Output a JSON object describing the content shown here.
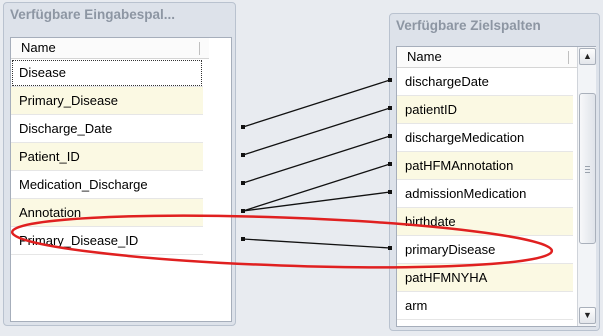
{
  "source_panel": {
    "title": "Verfügbare Eingabespal...",
    "column_header": "Name",
    "items": [
      {
        "label": "Disease"
      },
      {
        "label": "Primary_Disease"
      },
      {
        "label": "Discharge_Date"
      },
      {
        "label": "Patient_ID"
      },
      {
        "label": "Medication_Discharge"
      },
      {
        "label": "Annotation"
      },
      {
        "label": "Primary_Disease_ID"
      }
    ]
  },
  "target_panel": {
    "title": "Verfügbare Zielspalten",
    "column_header": "Name",
    "items": [
      {
        "label": "dischargeDate"
      },
      {
        "label": "patientID"
      },
      {
        "label": "dischargeMedication"
      },
      {
        "label": "patHFMAnnotation"
      },
      {
        "label": "admissionMedication"
      },
      {
        "label": "birthdate"
      },
      {
        "label": "primaryDisease"
      },
      {
        "label": "patHFMNYHA"
      },
      {
        "label": "arm"
      }
    ],
    "scrollbar": {
      "up_icon": "▲",
      "down_icon": "▼"
    }
  },
  "mappings": [
    {
      "source": "Discharge_Date",
      "target": "dischargeDate"
    },
    {
      "source": "Patient_ID",
      "target": "patientID"
    },
    {
      "source": "Medication_Discharge",
      "target": "dischargeMedication"
    },
    {
      "source": "Annotation",
      "target": "patHFMAnnotation"
    },
    {
      "source": "Annotation",
      "target": "admissionMedication"
    },
    {
      "source": "Primary_Disease_ID",
      "target": "primaryDisease"
    }
  ],
  "annotation": {
    "shape": "ellipse",
    "color": "#e02020",
    "highlighted_source": "Primary_Disease_ID",
    "highlighted_target": "primaryDisease"
  },
  "colors": {
    "row_alt": "#fbf9e3",
    "panel_bg": "#dde2ea",
    "title_text": "#8d96a3"
  }
}
